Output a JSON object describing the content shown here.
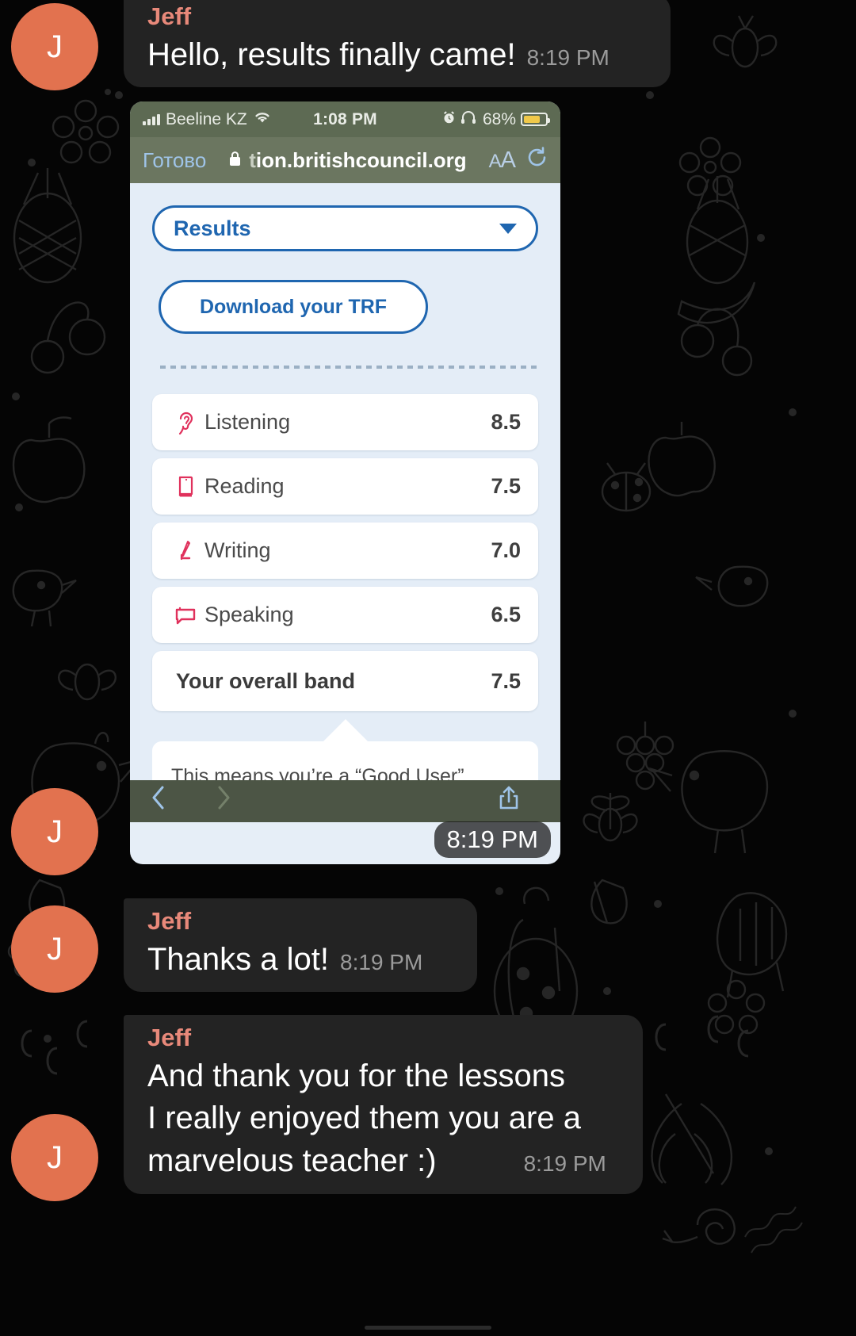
{
  "theme": {
    "bubble_bg": "#232323",
    "sender_color": "#e8897a",
    "avatar_bg": "#e2724f",
    "accent_blue": "#1f66b0",
    "score_icon_color": "#e0315c",
    "page_bg": "#e4edf7"
  },
  "messages": [
    {
      "sender": "Jeff",
      "avatar_initial": "J",
      "lines": [
        "Hello, results finally came!"
      ],
      "time": "8:19 PM"
    },
    {
      "sender": "Jeff",
      "avatar_initial": "J",
      "lines": [
        "Thanks a lot!"
      ],
      "time": "8:19 PM"
    },
    {
      "sender": "Jeff",
      "avatar_initial": "J",
      "lines": [
        "And thank you for the lessons",
        "I really enjoyed them you are a",
        "marvelous teacher :)"
      ],
      "time": "8:19 PM"
    }
  ],
  "attachment": {
    "time": "8:19 PM",
    "status_bar": {
      "carrier": "Beeline KZ",
      "signal_icon": "signal-bars-icon",
      "wifi_icon": "wifi-icon",
      "clock": "1:08 PM",
      "alarm_icon": "alarm-icon",
      "headphones_icon": "headphones-icon",
      "battery_percent": "68%",
      "battery_icon": "battery-icon"
    },
    "browser": {
      "done_label": "Готово",
      "lock_icon": "lock-icon",
      "url_prefix": "t",
      "url_main": "ion.britishcouncil.org",
      "text_size_label": "AA",
      "reload_icon": "reload-icon",
      "back_icon": "chevron-left-icon",
      "forward_icon": "chevron-right-icon",
      "share_icon": "share-icon"
    },
    "page": {
      "select_label": "Results",
      "select_chevron_icon": "chevron-down-icon",
      "download_button": "Download your TRF",
      "scores": [
        {
          "icon": "ear-icon",
          "label": "Listening",
          "value": "8.5",
          "total": false
        },
        {
          "icon": "book-icon",
          "label": "Reading",
          "value": "7.5",
          "total": false
        },
        {
          "icon": "pencil-icon",
          "label": "Writing",
          "value": "7.0",
          "total": false
        },
        {
          "icon": "speech-bubble-icon",
          "label": "Speaking",
          "value": "6.5",
          "total": false
        },
        {
          "icon": "none",
          "label": "Your overall band",
          "value": "7.5",
          "total": true
        }
      ],
      "good_user_note": "This means you’re a “Good User”"
    }
  }
}
